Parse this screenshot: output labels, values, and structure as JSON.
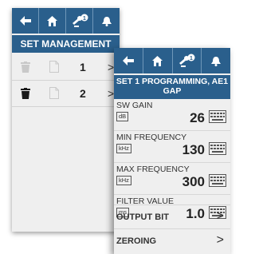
{
  "back_screen": {
    "title": "SET MANAGEMENT",
    "badge": "1",
    "rows": [
      {
        "number": "1",
        "delete_enabled": false
      },
      {
        "number": "2",
        "delete_enabled": true
      }
    ]
  },
  "front_screen": {
    "badge": "1",
    "title_line1": "SET 1 PROGRAMMING, AE1",
    "title_line2": "GAP",
    "params": [
      {
        "label": "SW GAIN",
        "unit": "dB",
        "value": "26"
      },
      {
        "label": "MIN FREQUENCY",
        "unit": "kHz",
        "value": "130"
      },
      {
        "label": "MAX FREQUENCY",
        "unit": "kHz",
        "value": "300"
      },
      {
        "label": "FILTER VALUE",
        "unit": "ms",
        "value": "1.0"
      }
    ],
    "menu": [
      {
        "label": "OUTPUT BIT"
      },
      {
        "label": "ZEROING"
      }
    ]
  },
  "colors": {
    "header_blue": "#2a5f8c",
    "panel_bg": "#efefef"
  }
}
